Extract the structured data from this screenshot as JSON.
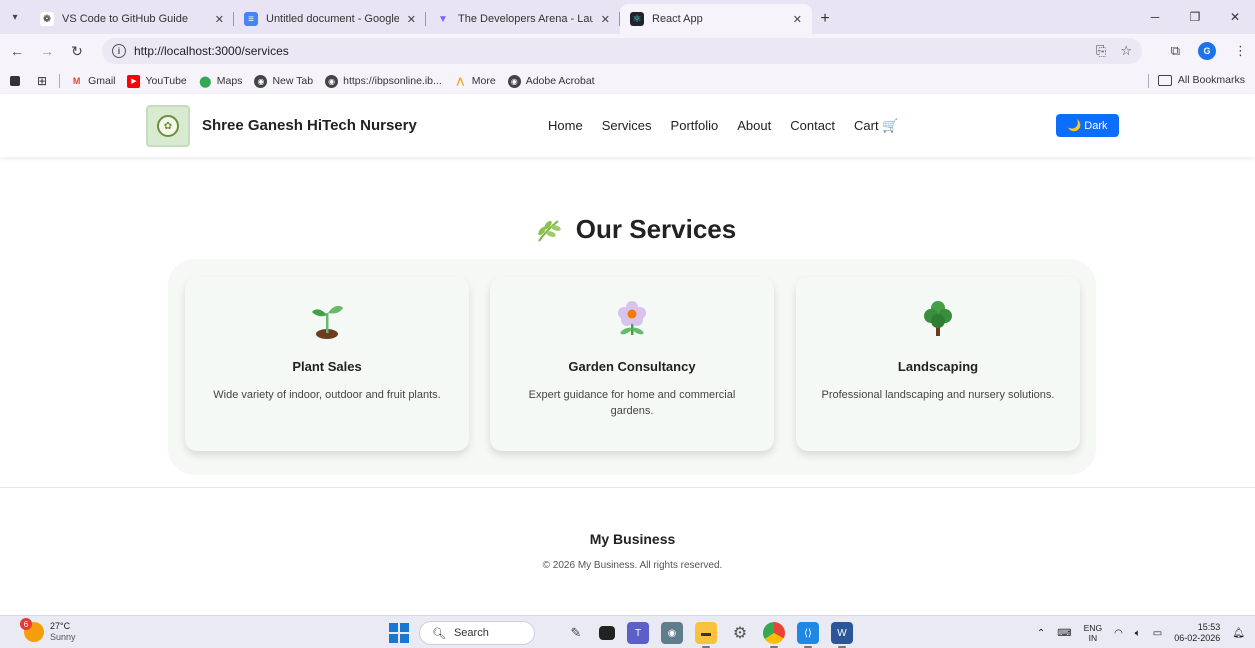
{
  "browser": {
    "tabs": [
      {
        "title": "VS Code to GitHub Guide",
        "icon": "openai-icon",
        "active": false
      },
      {
        "title": "Untitled document - Google Do",
        "icon": "google-docs-icon",
        "active": false
      },
      {
        "title": "The Developers Arena - Launch",
        "icon": "vite-icon",
        "active": false
      },
      {
        "title": "React App",
        "icon": "react-icon",
        "active": true
      }
    ],
    "url": "http://localhost:3000/services",
    "bookmarks": [
      {
        "label": "Gmail",
        "icon": "gmail-icon"
      },
      {
        "label": "YouTube",
        "icon": "youtube-icon"
      },
      {
        "label": "Maps",
        "icon": "maps-icon"
      },
      {
        "label": "New Tab",
        "icon": "globe-icon"
      },
      {
        "label": "https://ibpsonline.ib...",
        "icon": "globe-icon"
      },
      {
        "label": "More",
        "icon": "more-icon"
      },
      {
        "label": "Adobe Acrobat",
        "icon": "globe-icon"
      }
    ],
    "all_bookmarks": "All Bookmarks",
    "profile_initial": "G"
  },
  "site": {
    "brand": "Shree Ganesh HiTech Nursery",
    "nav": [
      "Home",
      "Services",
      "Portfolio",
      "About",
      "Contact",
      "Cart 🛒"
    ],
    "theme_toggle": "🌙 Dark"
  },
  "services": {
    "title": "Our Services",
    "items": [
      {
        "title": "Plant Sales",
        "description": "Wide variety of indoor, outdoor and fruit plants.",
        "icon": "seedling-icon"
      },
      {
        "title": "Garden Consultancy",
        "description": "Expert guidance for home and commercial gardens.",
        "icon": "flower-icon"
      },
      {
        "title": "Landscaping",
        "description": "Professional landscaping and nursery solutions.",
        "icon": "tree-icon"
      }
    ]
  },
  "footer": {
    "title": "My Business",
    "copyright": "© 2026 My Business. All rights reserved."
  },
  "taskbar": {
    "weather_temp": "27°C",
    "weather_condition": "Sunny",
    "weather_badge": "6",
    "search_placeholder": "Search",
    "lang_top": "ENG",
    "lang_bottom": "IN",
    "time": "15:53",
    "date": "06-02-2026"
  }
}
